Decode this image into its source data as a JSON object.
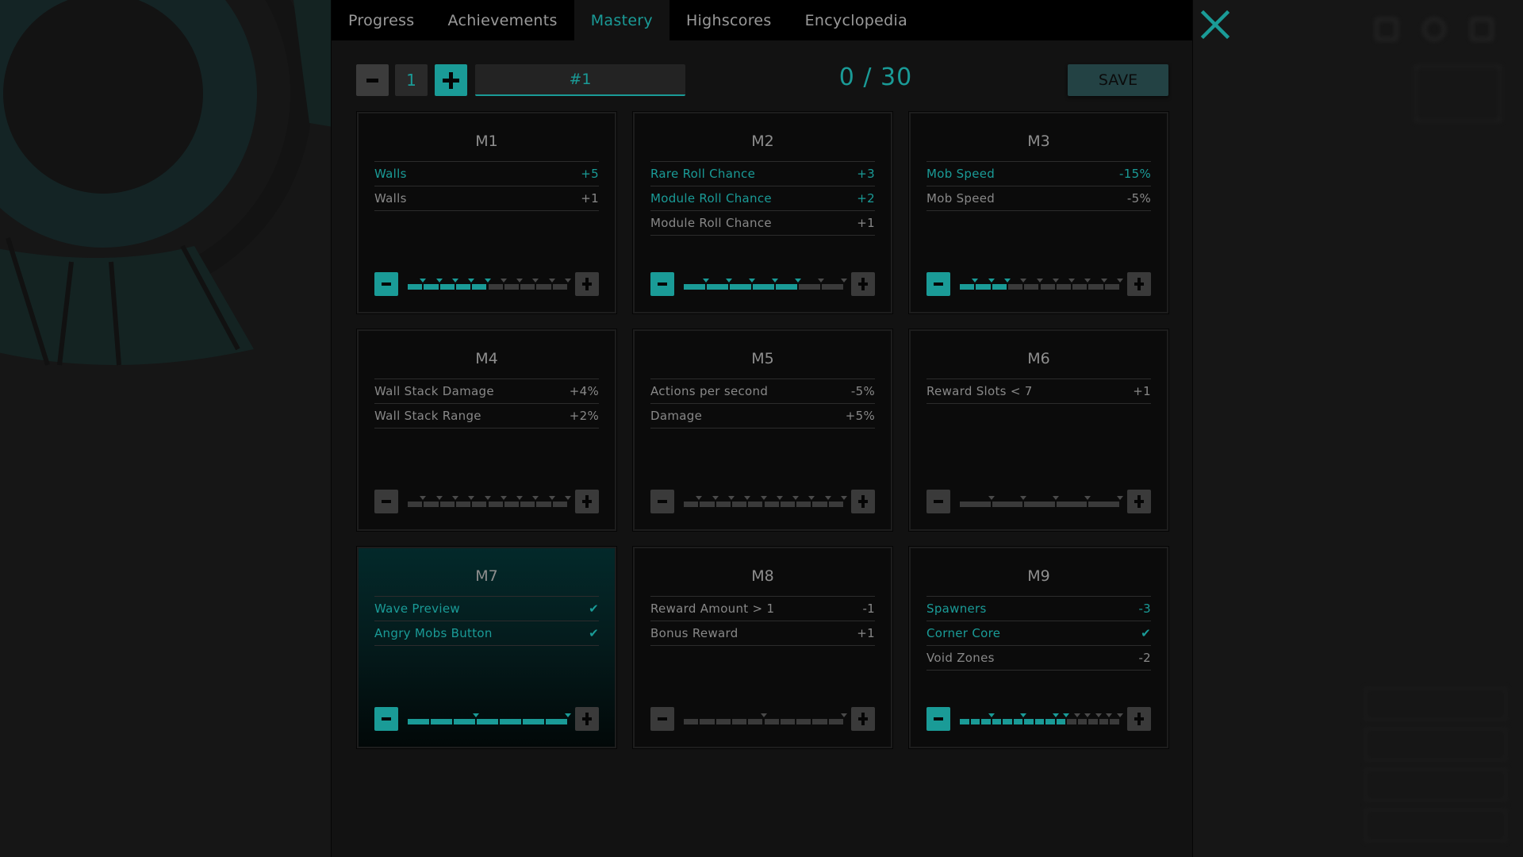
{
  "tabs": [
    {
      "label": "Progress",
      "active": false
    },
    {
      "label": "Achievements",
      "active": false
    },
    {
      "label": "Mastery",
      "active": true
    },
    {
      "label": "Highscores",
      "active": false
    },
    {
      "label": "Encyclopedia",
      "active": false
    }
  ],
  "close_icon": "close-x-icon",
  "controls": {
    "preset_minus_icon": "minus-icon",
    "preset_number": "1",
    "preset_plus_icon": "plus-icon",
    "preset_name": "#1",
    "points": "0 / 30",
    "save_label": "SAVE"
  },
  "colors": {
    "accent": "#1a9b97",
    "inactive": "#3a3a3a",
    "save_bg": "#234244",
    "panel_bg": "#121212"
  },
  "cards": [
    {
      "title": "M1",
      "highlight": false,
      "level": 5,
      "max": 10,
      "markers": [
        1,
        2,
        3,
        4,
        5,
        6,
        7,
        8,
        9,
        10
      ],
      "rows": [
        {
          "label": "Walls",
          "value": "+5",
          "active": true
        },
        {
          "label": "Walls",
          "value": "+1",
          "active": false
        }
      ]
    },
    {
      "title": "M2",
      "highlight": false,
      "level": 5,
      "max": 7,
      "markers": [
        1,
        2,
        3,
        4,
        5,
        6,
        7
      ],
      "rows": [
        {
          "label": "Rare Roll Chance",
          "value": "+3",
          "active": true
        },
        {
          "label": "Module Roll Chance",
          "value": "+2",
          "active": true
        },
        {
          "label": "Module Roll Chance",
          "value": "+1",
          "active": false
        }
      ]
    },
    {
      "title": "M3",
      "highlight": false,
      "level": 3,
      "max": 10,
      "markers": [
        1,
        2,
        3,
        4,
        5,
        6,
        7,
        8,
        9,
        10
      ],
      "rows": [
        {
          "label": "Mob Speed",
          "value": "-15%",
          "active": true
        },
        {
          "label": "Mob Speed",
          "value": "-5%",
          "active": false
        }
      ]
    },
    {
      "title": "M4",
      "highlight": false,
      "level": 0,
      "max": 10,
      "markers": [
        1,
        2,
        3,
        4,
        5,
        6,
        7,
        8,
        9,
        10
      ],
      "rows": [
        {
          "label": "Wall Stack Damage",
          "value": "+4%",
          "active": false
        },
        {
          "label": "Wall Stack Range",
          "value": "+2%",
          "active": false
        }
      ]
    },
    {
      "title": "M5",
      "highlight": false,
      "level": 0,
      "max": 10,
      "markers": [
        1,
        2,
        3,
        4,
        5,
        6,
        7,
        8,
        9,
        10
      ],
      "rows": [
        {
          "label": "Actions per second",
          "value": "-5%",
          "active": false
        },
        {
          "label": "Damage",
          "value": "+5%",
          "active": false
        }
      ]
    },
    {
      "title": "M6",
      "highlight": false,
      "level": 0,
      "max": 5,
      "markers": [
        1,
        2,
        3,
        4,
        5
      ],
      "rows": [
        {
          "label": "Reward Slots < 7",
          "value": "+1",
          "active": false
        }
      ]
    },
    {
      "title": "M7",
      "highlight": true,
      "level": 7,
      "max": 7,
      "markers": [
        3,
        7
      ],
      "rows": [
        {
          "label": "Wave Preview",
          "value": "✔",
          "active": true
        },
        {
          "label": "Angry Mobs Button",
          "value": "✔",
          "active": true
        }
      ]
    },
    {
      "title": "M8",
      "highlight": false,
      "level": 0,
      "max": 10,
      "markers": [
        5,
        10
      ],
      "rows": [
        {
          "label": "Reward Amount > 1",
          "value": "-1",
          "active": false
        },
        {
          "label": "Bonus Reward",
          "value": "+1",
          "active": false
        }
      ]
    },
    {
      "title": "M9",
      "highlight": false,
      "level": 10,
      "max": 15,
      "markers": [
        3,
        6,
        9,
        10,
        11,
        12,
        13,
        14,
        15
      ],
      "rows": [
        {
          "label": "Spawners",
          "value": "-3",
          "active": true
        },
        {
          "label": "Corner Core",
          "value": "✔",
          "active": true
        },
        {
          "label": "Void Zones",
          "value": "-2",
          "active": false
        }
      ]
    }
  ]
}
